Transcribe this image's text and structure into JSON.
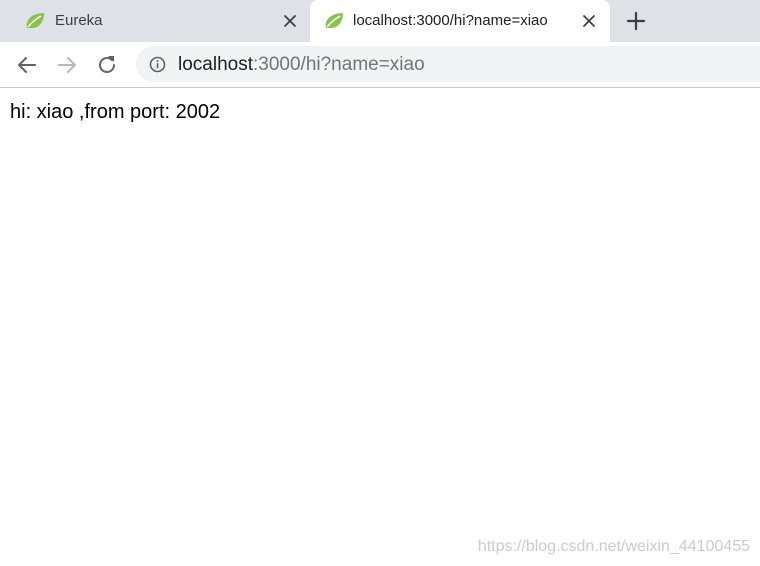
{
  "browser": {
    "tabs": [
      {
        "title": "Eureka",
        "favicon": "spring-leaf-icon",
        "active": false
      },
      {
        "title": "localhost:3000/hi?name=xiao",
        "favicon": "spring-leaf-icon",
        "active": true
      }
    ],
    "new_tab_icon": "plus-icon",
    "toolbar": {
      "back_icon": "arrow-left-icon",
      "forward_icon": "arrow-right-icon",
      "reload_icon": "reload-icon",
      "site_info_icon": "info-icon"
    },
    "address_bar": {
      "host": "localhost",
      "rest": ":3000/hi?name=xiao"
    }
  },
  "page": {
    "text": "hi: xiao ,from port: 2002"
  },
  "watermark": "https://blog.csdn.net/weixin_44100455",
  "colors": {
    "tabstrip": "#dee1e6",
    "leaf": "#8bc34a",
    "url_rest": "#707579"
  }
}
